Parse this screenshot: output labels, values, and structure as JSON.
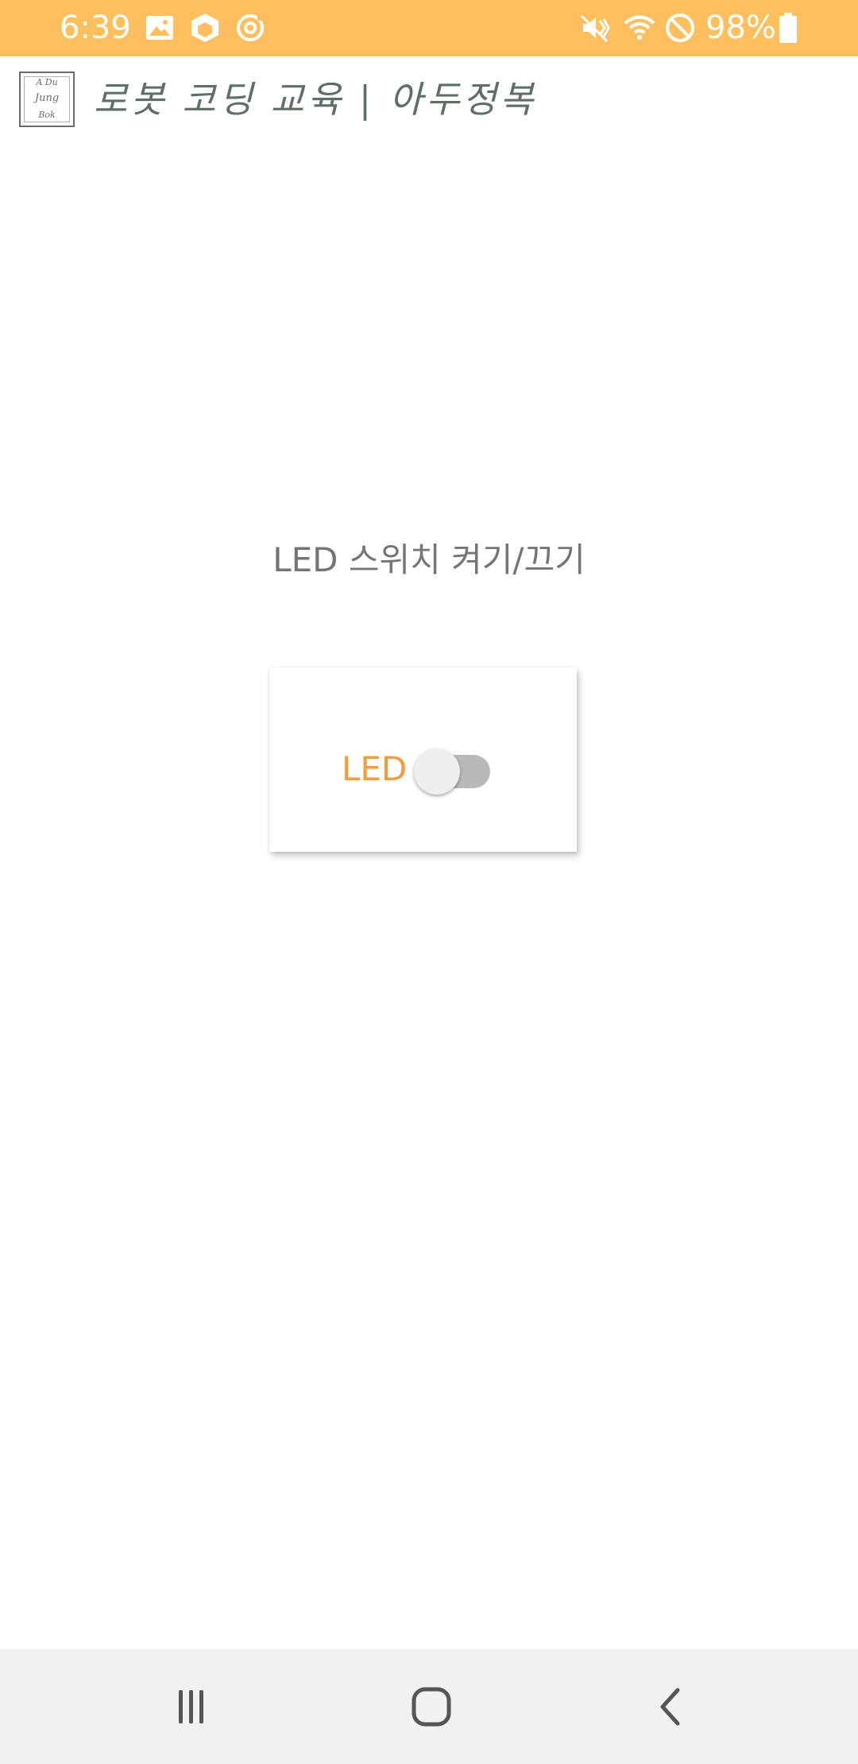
{
  "status_bar": {
    "time": "6:39",
    "battery": "98%",
    "background_color": "#ffbf5e",
    "left_icons": [
      "image-icon",
      "package-icon",
      "sync-icon"
    ],
    "right_icons": [
      "vibrate-icon",
      "wifi-icon",
      "do-not-disturb-icon",
      "battery-icon"
    ]
  },
  "app_header": {
    "title": "로봇 코딩 교육 | 아두정복",
    "logo_lines": [
      "A Du",
      "Jung",
      "Bok"
    ],
    "title_color": "#5e6f66"
  },
  "main": {
    "heading": "LED 스위치 켜기/끄기",
    "card": {
      "switch_label": "LED",
      "switch_label_color": "#f29c3c",
      "switch_state": "off"
    }
  },
  "nav_bar": {
    "buttons": [
      "recent-apps-icon",
      "home-icon",
      "back-icon"
    ]
  }
}
